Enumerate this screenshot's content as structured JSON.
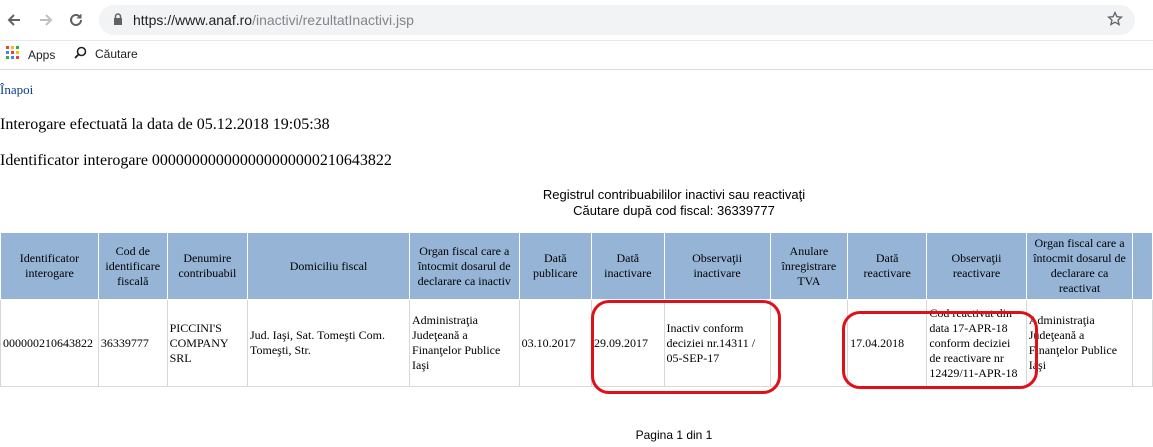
{
  "browser": {
    "url_host": "https://www.anaf.ro",
    "url_path": "/inactivi/rezultatInactivi.jsp",
    "bookmarks": [
      {
        "label": "Apps",
        "icon": "apps-grid-icon"
      },
      {
        "label": "Căutare",
        "icon": "search-icon"
      }
    ]
  },
  "page": {
    "back_link": "Înapoi",
    "query_date_line": "Interogare efectuată la data de 05.12.2018 19:05:38",
    "query_id_line": "Identificator interogare 000000000000000000000210643822",
    "registry_title": "Registrul contribuabililor inactivi sau reactivaţi",
    "registry_subtitle": "Căutare după cod fiscal: 36339777",
    "pagination": "Pagina 1 din 1"
  },
  "table": {
    "headers": [
      "Identificator interogare",
      "Cod de identificare fiscală",
      "Denumire contribuabil",
      "Domiciliu fiscal",
      "Organ fiscal care a întocmit dosarul de declarare ca inactiv",
      "Dată publicare",
      "Dată inactivare",
      "Observaţii inactivare",
      "Anulare înregistrare TVA",
      "Dată reactivare",
      "Observaţii reactivare",
      "Organ fiscal care a întocmit dosarul de declarare ca reactivat"
    ],
    "rows": [
      {
        "id": "000000210643822",
        "cif": "36339777",
        "name": "PICCINI'S COMPANY SRL",
        "address": "Jud. Iaşi, Sat. Tomeşti Com. Tomeşti, Str.",
        "organ_inactiv": "Administraţia Judeţeană a Finanţelor Publice Iaşi",
        "publish_date": "03.10.2017",
        "inactivation_date": "29.09.2017",
        "inactivation_notes": "Inactiv conform deciziei nr.14311 / 05-SEP-17",
        "vat_cancel": "",
        "reactivation_date": "17.04.2018",
        "reactivation_notes": "Cod reactivat din data 17-APR-18 conform deciziei de reactivare nr 12429/11-APR-18",
        "organ_reactivat": "Administraţia Judeţeană a Finanţelor Publice Iaşi"
      }
    ]
  },
  "colors": {
    "header_bg": "#96b5d6",
    "highlight": "#e0101b",
    "link": "#0b3e8a"
  }
}
